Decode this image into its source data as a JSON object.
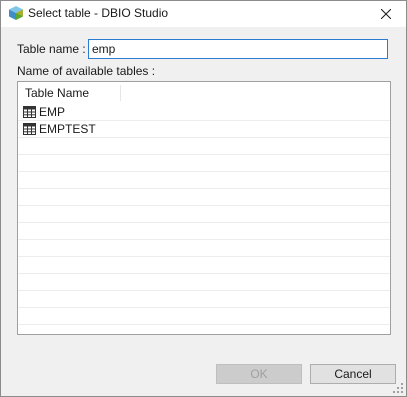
{
  "window": {
    "title": "Select table - DBIO Studio",
    "app_icon": "dbio-cube-icon",
    "close_icon": "close-icon"
  },
  "form": {
    "table_name_label": "Table name :",
    "table_name_value": "emp",
    "available_label": "Name of available tables :"
  },
  "table": {
    "column_header": "Table Name",
    "rows": [
      {
        "label": "EMP",
        "icon": "table-icon"
      },
      {
        "label": "EMPTEST",
        "icon": "table-icon"
      }
    ],
    "empty_row_count": 14
  },
  "buttons": {
    "ok_label": "OK",
    "ok_enabled": false,
    "cancel_label": "Cancel"
  },
  "colors": {
    "accent": "#2b7bd0",
    "dialog_bg": "#f0f0f0"
  }
}
